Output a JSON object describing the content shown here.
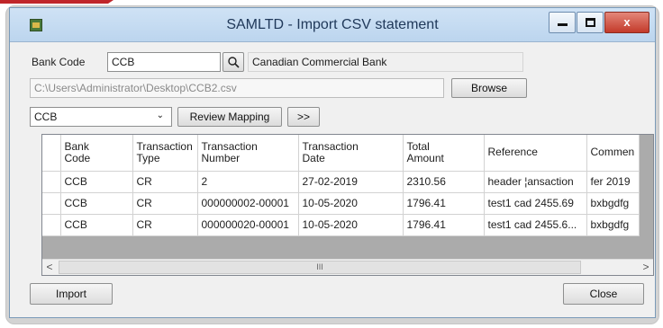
{
  "window": {
    "title": "SAMLTD - Import CSV statement"
  },
  "bank_code": {
    "label": "Bank Code",
    "value": "CCB",
    "name": "Canadian Commercial Bank"
  },
  "file": {
    "path": "C:\\Users\\Administrator\\Desktop\\CCB2.csv",
    "browse_label": "Browse"
  },
  "mapping": {
    "selected": "CCB",
    "review_label": "Review Mapping",
    "next_label": ">>"
  },
  "grid": {
    "columns": [
      "Bank\nCode",
      "Transaction\nType",
      "Transaction\nNumber",
      "Transaction\nDate",
      "Total\nAmount",
      "Reference",
      "Commen"
    ],
    "rows": [
      [
        "CCB",
        "CR",
        "2",
        "27-02-2019",
        "2310.56",
        "header ¦ansaction",
        "fer 2019"
      ],
      [
        "CCB",
        "CR",
        "000000002-00001",
        "10-05-2020",
        "1796.41",
        "test1 cad 2455.69",
        "bxbgdfg"
      ],
      [
        "CCB",
        "CR",
        "000000020-00001",
        "10-05-2020",
        "1796.41",
        "test1 cad 2455.6...",
        "bxbgdfg"
      ]
    ],
    "scroll_left": "<",
    "scroll_right": ">",
    "scroll_grip": "III"
  },
  "footer": {
    "import_label": "Import",
    "close_label": "Close"
  },
  "icons": {
    "app": "app-icon",
    "search": "search-icon",
    "dropdown": "chevron-down-icon",
    "close": "close-icon",
    "minimize": "minimize-icon",
    "maximize": "maximize-icon"
  },
  "colors": {
    "close_button": "#c33a2a",
    "accent_red": "#c0262a"
  }
}
